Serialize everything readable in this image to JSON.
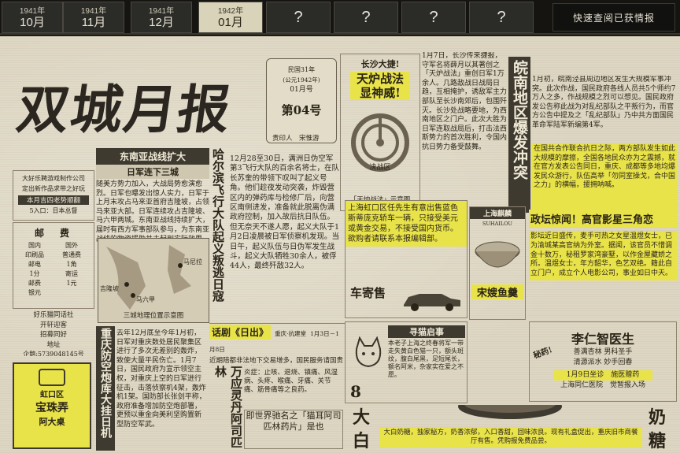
{
  "tabs": [
    {
      "year": "1941年",
      "month": "10月"
    },
    {
      "year": "1941年",
      "month": "11月"
    },
    {
      "year": "1941年",
      "month": "12月"
    },
    {
      "year": "1942年",
      "month": "01月"
    }
  ],
  "locked_tabs": [
    "?",
    "?",
    "?",
    "?"
  ],
  "quick_button": "快速查阅已获情报",
  "masthead": {
    "title": "双城月报",
    "issue_date_line1": "民国31年",
    "issue_date_line2": "(公元1942年)",
    "issue_date_line3": "01月号",
    "issue_no": "第04号",
    "editor": "责印人　宋惟游"
  },
  "changsha": {
    "tag": "长沙大捷!",
    "headline1": "天炉战法",
    "headline2": "显神威!",
    "caption": "「天炉战法」示意图",
    "center_label": "决战区",
    "body": "1月7日，长沙传来捷报，守军名将薛月以其著创之「天炉战法」重创日军1万余人。几路敌战日战局日趋，互相掩护，诱敌军主力部队至长沙南郊后，包围歼灭。长沙处战略要地，为西南地区之门户。此次大胜为日军连取战局后，打击法西斯势力的首次胜利，令国内抗日势力备受鼓舞。"
  },
  "wanan": {
    "headline": "皖南地区爆发冲突",
    "body": "1月初，皖南泾县周边地区发生大规模军事冲突。此次作战，国民政府各线人员共5个师约7万人之多，作战规模之烈可以想见。国民政府发公告称此战为对乱纪部队之平叛行为，而官方公告中提及之「乱纪部队」乃中共方面国民革命军陆军新编第4军。",
    "highlight": "在国共合作联合抗日之际，两方部队发生如此大规模的摩擦，全国各地民众亦为之震撼，就在官方发表公告同日，重庆、成都等多地均爆发民众游行，队伍高举「勿同室操戈，合中国之力」的横幅，援拥呐喊。"
  },
  "southeast": {
    "headline": "东南亚战线扩大",
    "subheadline": "日军连下三城",
    "body": "随美方势力加入，大战局势愈演愈烈。日军也曝发出惊人实力，日军于上月末攻占马来亚首府吉隆坡，占领马来亚大部。日军连续攻占吉隆坡、马六甲两城。东南亚战线持续扩大，届时有西方军事部队参与，为东南亚战线的物资援助并未起到实际效果。",
    "map_caption": "三城地理位置示意图",
    "map_labels": [
      "吉隆坡",
      "马六甲",
      "马尼拉"
    ]
  },
  "harbin": {
    "headline": "哈尔滨飞行大队起义叛逃日寇",
    "body": "12月28至30日，满洲日伪空军第3飞行大队的百余名将士，在队长苏奎的带领下叹叫了起义号角。他们趁夜发动突袭，炸毁营区内的弹药库与检修厂后，向营区南侧进发，准备就此脱离伪满政府控制，加入故后抗日队伍。但无奈天不遂人愿，起义大队于1月2日凌晨被日军侦察机发现。当日午，起义队伍与日伪军发生战斗，起义大队牺牲30余人，被俘44人，最终歼敌32人。"
  },
  "ad_dating": {
    "line1": "大好乐聘游戏制作公司",
    "line2": "定出新作品求带之好玩",
    "line3": "本月吉四老势顺翻",
    "line4": "5入口：日本总督"
  },
  "postal": {
    "title": "邮　费",
    "rows": [
      "国内",
      "国外",
      "印刷品",
      "普通费",
      "邮电",
      "1角",
      "1分",
      "寄运",
      "邮费",
      "1元",
      "银元"
    ]
  },
  "dating_ad": {
    "lines": [
      "好乐猫同话社",
      "开轩迎客",
      "招募同好",
      "地址",
      "企鹅:5739048145号"
    ]
  },
  "hongkou_car": {
    "text": "上海虹口区任先生有意出售蓝色斯蒂庞克轿车一辆，只接受美元或黄金交易，不接受国内货币。欲购者请联系本报编辑部。",
    "label": "车寄售"
  },
  "soup": {
    "brand": "上海麒麟",
    "brand_en": "SUHAILOU",
    "label": "宋嫂鱼羹"
  },
  "ad_sense": {
    "headline": "政坛惊闻！高官影星三角恋",
    "body": "影坛近日盛传，麦手可热之女星温煜女士，已为渝城某高官纳为外室。据闻，该官员不惜调金十数万，秘租罗家湾豪墅，以作金屋藏娇之所。温煜女士，年方韶华，色艺双绝。籍此自立门户，成立个人电影公司，事业如日中天。"
  },
  "drama": {
    "title": "话剧《日出》",
    "place": "重庆·抗建堂",
    "dates": "1月3日－1月8日",
    "body": "近期陪都非法地下交易增多，国民服务请国贵市民朋友前往药铺医院，正规购药"
  },
  "chongqing": {
    "headline": "重庆防空炮库大挂日机",
    "body": "去年12月底至今年1月初，日军对重庆数处居民聚集区进行了多次无差别的轰炸，致使大量平民伤亡。1月7日，国民政府为宣示领空主权，对重庆上空的日军进行征击，击落侦察机4架，轰炸机1架。国防部长张剑平称，政府准备增加防空炮部署，更预以重金向美利坚购置新型防空军武。"
  },
  "medicine": {
    "vtitle": "万应灵丹阿司匹林",
    "body": "炎症：止咳、退烧、镇痛、风湿病、头疼、喉痛、牙痛、关节痛、筋骨痛等之良药。",
    "tag": "即世界驰名之「猫耳阿司匹林药片」是也"
  },
  "cat": {
    "title": "寻猫启事",
    "body": "本老子上海之终春将军一带走失黄白色猫一只，额头斑纹，腹白尾黑，足短尾长，额名阿米，杂家实在爱之不愿。",
    "number": "8"
  },
  "doctor": {
    "name": "李仁智医生",
    "specialty": "善满杏林 男科圣手",
    "clinic": "清源派水 妙手回春",
    "date": "1月9日坐诊　施医赠药",
    "location": "上海同仁医院　觉暂报入场",
    "tag": "秘药!"
  },
  "milk": {
    "big": [
      "大",
      "白",
      "奶",
      "糖"
    ],
    "text": "大白奶糖，独家秘方，奶香浓郁，入口香甜，回味浓良。现有礼盒促出，重庆旧市商餐厅有售。凭购报免费品尝。"
  },
  "jewelry": {
    "area": "虹口区",
    "name": "宝珠弄",
    "sub": "阿大桌"
  }
}
